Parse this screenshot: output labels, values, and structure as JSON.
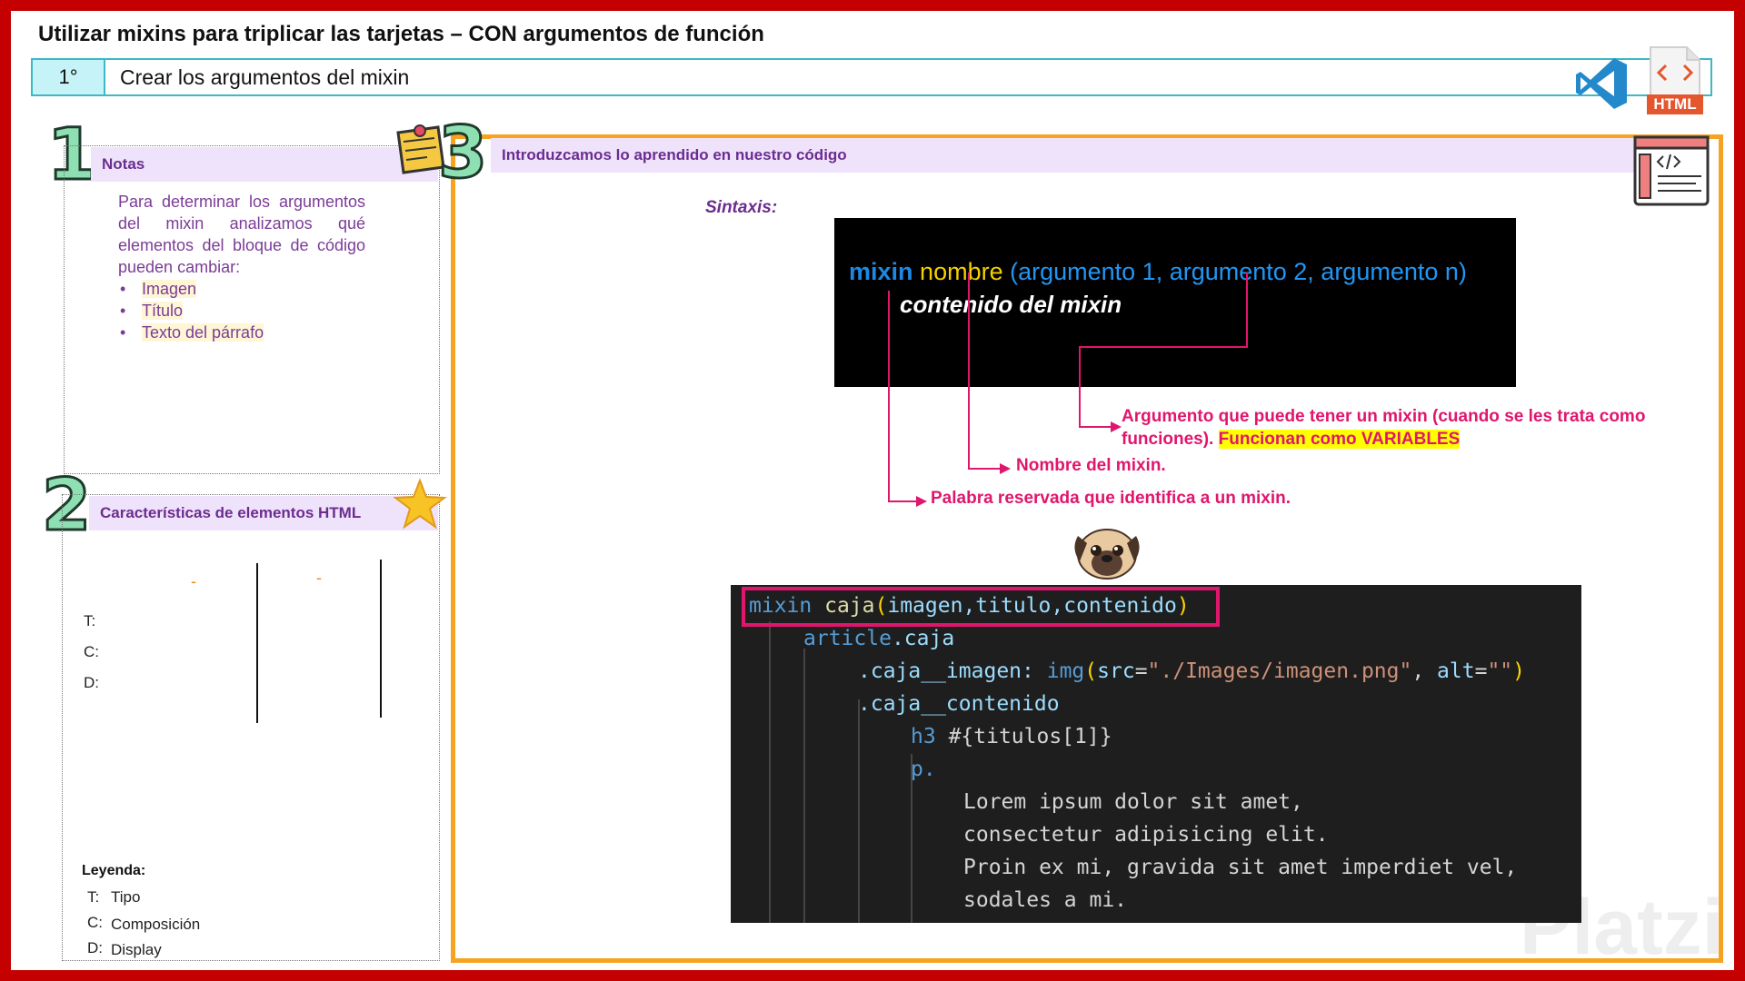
{
  "title": "Utilizar mixins para triplicar las tarjetas – CON argumentos de función",
  "step": {
    "number": "1°",
    "text": "Crear los argumentos del mixin"
  },
  "html_badge": "HTML",
  "notes": {
    "number": "1",
    "title": "Notas",
    "paragraph": "Para determinar los argumentos del mixin analizamos qué elementos del bloque de código pueden cambiar:",
    "items": [
      "Imagen",
      "Título",
      "Texto del párrafo"
    ]
  },
  "characteristics": {
    "number": "2",
    "title": "Características de elementos HTML",
    "col_marks": [
      "-",
      "-"
    ],
    "rows": [
      "T:",
      "C:",
      "D:"
    ],
    "legend_title": "Leyenda:",
    "legend": [
      {
        "key": "T:",
        "value": "Tipo"
      },
      {
        "key": "C:",
        "value": "Composición"
      },
      {
        "key": "D:",
        "value": "Display"
      }
    ]
  },
  "main": {
    "number": "3",
    "title": "Introduzcamos lo aprendido en nuestro código",
    "syntax_label": "Sintaxis:",
    "syntax": {
      "keyword": "mixin",
      "name": "nombre",
      "args": "(argumento 1, argumento 2, argumento n)",
      "content": "contenido del mixin"
    },
    "annotations": {
      "argument_1": "Argumento que puede tener un mixin (cuando se les trata como funciones).",
      "argument_highlight": "Funcionan como VARIABLES",
      "name": "Nombre del mixin.",
      "keyword": "Palabra reservada que identifica a un mixin."
    },
    "code": {
      "line1": {
        "kw": "mixin",
        "fn": "caja",
        "open": "(",
        "args": "imagen,titulo,contenido",
        "close": ")"
      },
      "line2": {
        "tag": "article",
        "cls": ".caja"
      },
      "line3": {
        "cls": ".caja__imagen:",
        "tag": "img",
        "open": "(",
        "a1": "src",
        "eq1": "=",
        "s1": "\"./Images/imagen.png\"",
        "comma": ", ",
        "a2": "alt",
        "eq2": "=",
        "s2": "\"\"",
        "close": ")"
      },
      "line4": {
        "cls": ".caja__contenido"
      },
      "line5": {
        "tag": "h3",
        "interp": "#{titulos[1]}"
      },
      "line6": {
        "tag": "p."
      },
      "text_lines": [
        "Lorem ipsum dolor sit amet,",
        "consectetur adipisicing elit.",
        "Proin ex mi, gravida sit amet imperdiet vel,",
        "sodales a mi."
      ]
    },
    "watermark": "Platzi"
  }
}
